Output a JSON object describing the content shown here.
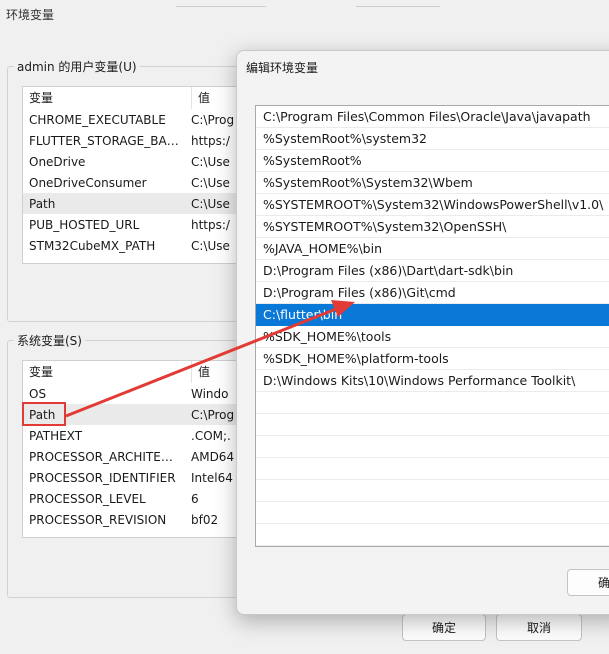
{
  "window": {
    "title": "环境变量"
  },
  "user_vars": {
    "group_label": "admin 的用户变量(U)",
    "columns": [
      "变量",
      "值"
    ],
    "rows": [
      {
        "name": "CHROME_EXECUTABLE",
        "value": "C:\\Prog"
      },
      {
        "name": "FLUTTER_STORAGE_BASE_...",
        "value": "https:/"
      },
      {
        "name": "OneDrive",
        "value": "C:\\Use"
      },
      {
        "name": "OneDriveConsumer",
        "value": "C:\\Use"
      },
      {
        "name": "Path",
        "value": "C:\\Use"
      },
      {
        "name": "PUB_HOSTED_URL",
        "value": "https:/"
      },
      {
        "name": "STM32CubeMX_PATH",
        "value": "C:\\Use"
      }
    ]
  },
  "system_vars": {
    "group_label": "系统变量(S)",
    "columns": [
      "变量",
      "值"
    ],
    "rows": [
      {
        "name": "OS",
        "value": "Windo"
      },
      {
        "name": "Path",
        "value": "C:\\Prog"
      },
      {
        "name": "PATHEXT",
        "value": ".COM;."
      },
      {
        "name": "PROCESSOR_ARCHITECT...",
        "value": "AMD64"
      },
      {
        "name": "PROCESSOR_IDENTIFIER",
        "value": "Intel64"
      },
      {
        "name": "PROCESSOR_LEVEL",
        "value": "6"
      },
      {
        "name": "PROCESSOR_REVISION",
        "value": "bf02"
      }
    ]
  },
  "dialog": {
    "title": "编辑环境变量",
    "paths": [
      "C:\\Program Files\\Common Files\\Oracle\\Java\\javapath",
      "%SystemRoot%\\system32",
      "%SystemRoot%",
      "%SystemRoot%\\System32\\Wbem",
      "%SYSTEMROOT%\\System32\\WindowsPowerShell\\v1.0\\",
      "%SYSTEMROOT%\\System32\\OpenSSH\\",
      "%JAVA_HOME%\\bin",
      "D:\\Program Files (x86)\\Dart\\dart-sdk\\bin",
      "D:\\Program Files (x86)\\Git\\cmd",
      "C:\\flutter\\bin",
      "%SDK_HOME%\\tools",
      "%SDK_HOME%\\platform-tools",
      "D:\\Windows Kits\\10\\Windows Performance Toolkit\\"
    ],
    "selected_index": 9,
    "ok_fragment": "确"
  },
  "buttons": {
    "ok": "确定",
    "cancel": "取消"
  },
  "colors": {
    "accent": "#0a78d7",
    "annotation": "#e23b36"
  }
}
